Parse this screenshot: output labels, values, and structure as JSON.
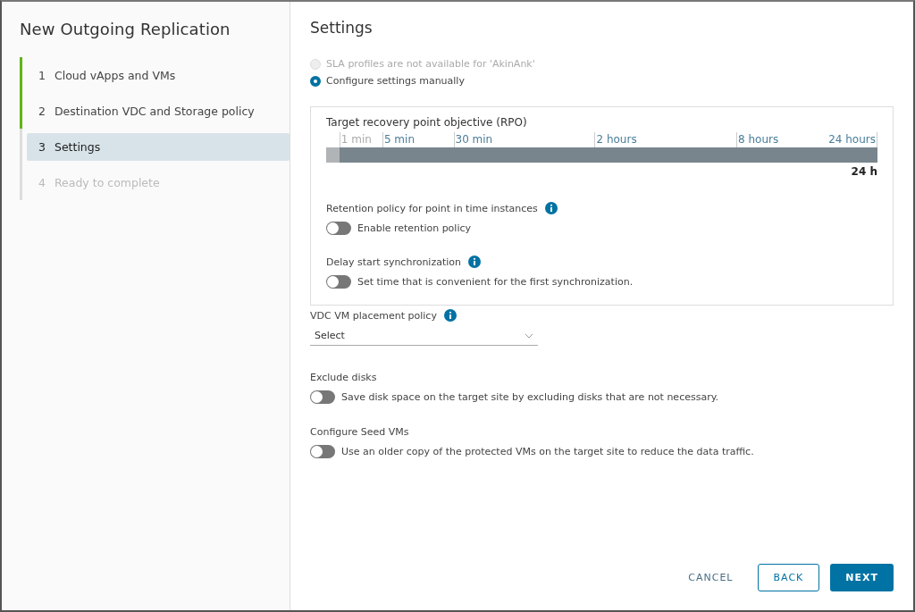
{
  "wizard": {
    "title": "New Outgoing Replication",
    "steps": [
      {
        "number": "1",
        "label": "Cloud vApps and VMs",
        "completed": true,
        "selected": false,
        "disabled": false
      },
      {
        "number": "2",
        "label": "Destination VDC and Storage policy",
        "completed": true,
        "selected": false,
        "disabled": false
      },
      {
        "number": "3",
        "label": "Settings",
        "completed": false,
        "selected": true,
        "disabled": false
      },
      {
        "number": "4",
        "label": "Ready to complete",
        "completed": false,
        "selected": false,
        "disabled": true
      }
    ]
  },
  "settings": {
    "title": "Settings",
    "options": [
      {
        "label": "SLA profiles are not available for 'AkinAnk'",
        "selected": false,
        "disabled": true
      },
      {
        "label": "Configure settings manually",
        "selected": true,
        "disabled": false
      }
    ],
    "rpo": {
      "label": "Target recovery point objective (RPO)",
      "ticks": [
        {
          "label": "1 min",
          "disabled": true
        },
        {
          "label": "5 min",
          "disabled": false
        },
        {
          "label": "30 min",
          "disabled": false
        },
        {
          "label": "2 hours",
          "disabled": false
        },
        {
          "label": "8 hours",
          "disabled": false
        },
        {
          "label": "24 hours",
          "disabled": false
        }
      ],
      "level": 1.0,
      "reading": "24 h"
    },
    "box_toggles": [
      {
        "heading": "Retention policy for point in time instances",
        "info": true,
        "label": "Enable retention policy",
        "on": false
      },
      {
        "heading": "Delay start synchronization",
        "info": true,
        "label": "Set time that is convenient for the first synchronization.",
        "on": false
      }
    ],
    "placement": {
      "label": "VDC VM placement policy",
      "info": true,
      "value": "Select"
    },
    "toggles": [
      {
        "heading": "Exclude disks",
        "label": "Save disk space on the target site by excluding disks that are not necessary.",
        "on": false
      },
      {
        "heading": "Configure Seed VMs",
        "label": "Use an older copy of the protected VMs on the target site to reduce the data traffic.",
        "on": false
      }
    ]
  },
  "buttons": [
    {
      "label": "CANCEL",
      "kind": "flat"
    },
    {
      "label": "BACK",
      "kind": "outline"
    },
    {
      "label": "NEXT",
      "kind": "primary"
    }
  ]
}
